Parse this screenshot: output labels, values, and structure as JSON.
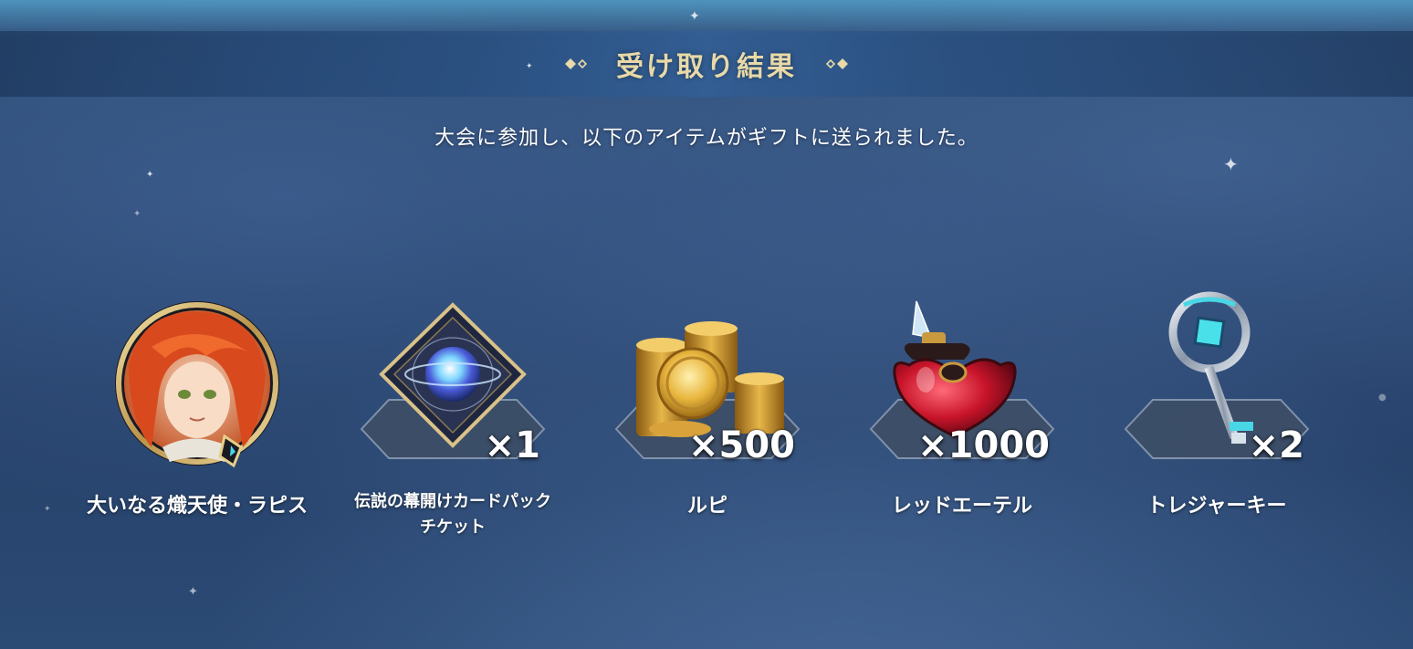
{
  "header": {
    "title": "受け取り結果",
    "subtitle": "大会に参加し、以下のアイテムがギフトに送られました。"
  },
  "items": [
    {
      "name": "大いなる熾天使・ラピス",
      "quantity": "",
      "icon": "character-portrait-icon"
    },
    {
      "name_line1": "伝説の幕開けカードパック",
      "name_line2": "チケット",
      "quantity": "×1",
      "icon": "card-pack-ticket-icon"
    },
    {
      "name": "ルピ",
      "quantity": "×500",
      "icon": "gold-coins-icon"
    },
    {
      "name": "レッドエーテル",
      "quantity": "×1000",
      "icon": "red-potion-icon"
    },
    {
      "name": "トレジャーキー",
      "quantity": "×2",
      "icon": "treasure-key-icon"
    }
  ],
  "colors": {
    "title_gold": "#e8d9a8",
    "background": "#2a4670",
    "text": "#ffffff"
  }
}
